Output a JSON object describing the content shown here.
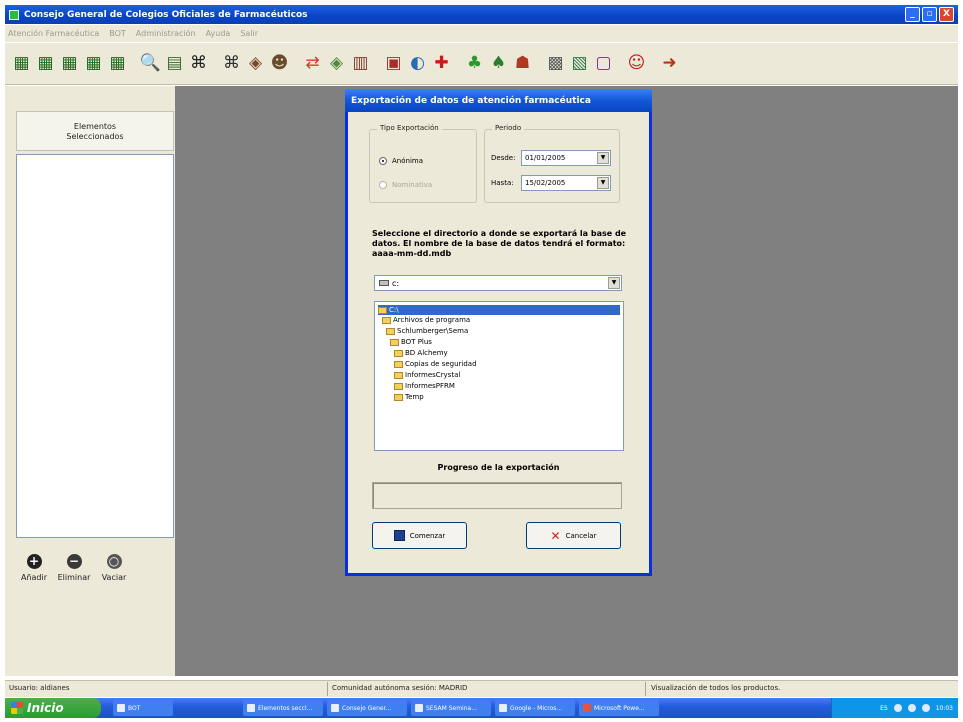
{
  "window": {
    "title": "Consejo General de Colegios Oficiales de Farmacéuticos",
    "controls": [
      "_",
      "▫",
      "X"
    ]
  },
  "menu": [
    "Atención Farmacéutica",
    "BOT",
    "Administración",
    "Ayuda",
    "Salir"
  ],
  "toolbar": {
    "icons": [
      "calculator-icon",
      "calculator-icon",
      "calculator-icon",
      "calculator-icon",
      "calculator-icon",
      "magnifier-icon",
      "report-icon",
      "binoculars-icon",
      "binoculars-icon",
      "capsule-icon",
      "people-icon",
      "swap-icon",
      "capsule-icon",
      "books-icon",
      "pharmacy-book-icon",
      "globe-icon",
      "medicine-icon",
      "plant-icon",
      "plant-icon",
      "family-icon",
      "tablet-icon",
      "chart-icon",
      "monitor-icon",
      "health-person-icon",
      "exit-icon"
    ]
  },
  "left_panel": {
    "header_line1": "Elementos",
    "header_line2": "Seleccionados",
    "add_label": "Añadir",
    "delete_label": "Eliminar",
    "clear_label": "Vaciar"
  },
  "dialog": {
    "title": "Exportación de datos de atención farmacéutica",
    "export_type": {
      "legend": "Tipo Exportación",
      "option_anonymous": "Anónima",
      "option_nominative": "Nominativa",
      "selected": "Anónima"
    },
    "period": {
      "legend": "Periodo",
      "from_label": "Desde:",
      "from_value": "01/01/2005",
      "to_label": "Hasta:",
      "to_value": "15/02/2005"
    },
    "instructions": "Seleccione el directorio a donde se exportará la base de datos. El nombre de la base de datos tendrá el formato: aaaa-mm-dd.mdb",
    "drive": "c:",
    "directories": [
      "C:\\",
      "Archivos de programa",
      "Schlumberger\\Sema",
      "BOT Plus",
      "BD Alchemy",
      "Copias de seguridad",
      "InformesCrystal",
      "InformesPFRM",
      "Temp"
    ],
    "selected_directory": "C:\\",
    "progress_label": "Progreso de la exportación",
    "progress_value": 0,
    "start_button": "Comenzar",
    "cancel_button": "Cancelar"
  },
  "status_bar": {
    "user": "Usuario: aldianes",
    "community": "Comunidad autónoma sesión: MADRID",
    "view": "Visualización de todos los productos."
  },
  "taskbar": {
    "start_label": "Inicio",
    "items": [
      "BOT",
      "Elementos seccl...",
      "Consejo Gener...",
      "SESAM Semina...",
      "Google - Micros...",
      "Microsoft Powe..."
    ],
    "language": "ES",
    "clock": "10:03"
  }
}
